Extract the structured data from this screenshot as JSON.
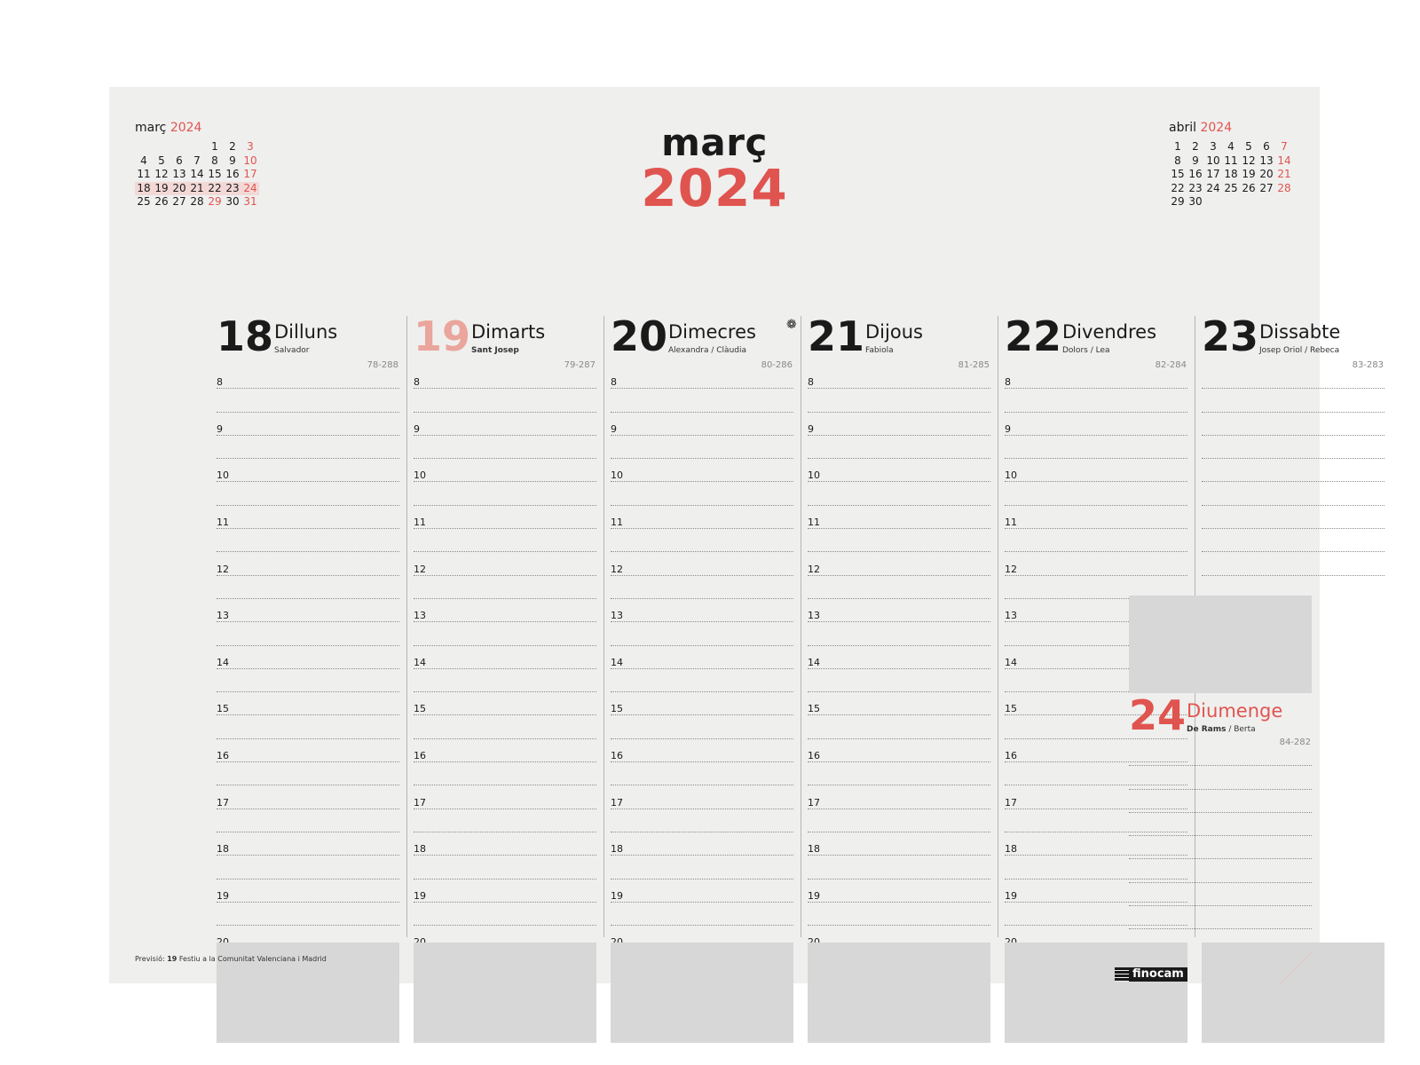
{
  "header": {
    "month": "març",
    "year": "2024"
  },
  "mini_left": {
    "month": "març",
    "year": "2024",
    "weeks": [
      [
        "",
        "",
        "",
        "",
        "1",
        "2",
        "3"
      ],
      [
        "4",
        "5",
        "6",
        "7",
        "8",
        "9",
        "10"
      ],
      [
        "11",
        "12",
        "13",
        "14",
        "15",
        "16",
        "17"
      ],
      [
        "18",
        "19",
        "20",
        "21",
        "22",
        "23",
        "24"
      ],
      [
        "25",
        "26",
        "27",
        "28",
        "29",
        "30",
        "31"
      ]
    ]
  },
  "mini_right": {
    "month": "abril",
    "year": "2024",
    "weeks": [
      [
        "1",
        "2",
        "3",
        "4",
        "5",
        "6",
        "7"
      ],
      [
        "8",
        "9",
        "10",
        "11",
        "12",
        "13",
        "14"
      ],
      [
        "15",
        "16",
        "17",
        "18",
        "19",
        "20",
        "21"
      ],
      [
        "22",
        "23",
        "24",
        "25",
        "26",
        "27",
        "28"
      ],
      [
        "29",
        "30",
        "",
        "",
        "",
        "",
        ""
      ]
    ]
  },
  "days": [
    {
      "num": "18",
      "name": "Dilluns",
      "saint": "Salvador",
      "count": "78-288"
    },
    {
      "num": "19",
      "name": "Dimarts",
      "saint": "Sant Josep",
      "count": "79-287"
    },
    {
      "num": "20",
      "name": "Dimecres",
      "saint": "Alexandra / Clàudia",
      "count": "80-286"
    },
    {
      "num": "21",
      "name": "Dijous",
      "saint": "Fabiola",
      "count": "81-285"
    },
    {
      "num": "22",
      "name": "Divendres",
      "saint": "Dolors / Lea",
      "count": "82-284"
    },
    {
      "num": "23",
      "name": "Dissabte",
      "saint": "Josep Oriol / Rebeca",
      "count": "83-283"
    }
  ],
  "sunday": {
    "num": "24",
    "name": "Diumenge",
    "saint_bold": "De Rams",
    "saint_rest": " / Berta",
    "count": "84-282"
  },
  "hours": [
    "8",
    "9",
    "10",
    "11",
    "12",
    "13",
    "14",
    "15",
    "16",
    "17",
    "18",
    "19",
    "20"
  ],
  "footnote": {
    "prefix": "Previsió: ",
    "day": "19",
    "text": " Festiu a la Comunitat Valenciana i Madrid"
  },
  "brand": "finocam",
  "colors": {
    "accent": "#e0544f",
    "holiday_soft": "#eaa59c",
    "paper": "#efefee",
    "box": "#d7d7d7"
  },
  "icons": {
    "moon_phase": "full-moon-icon"
  }
}
